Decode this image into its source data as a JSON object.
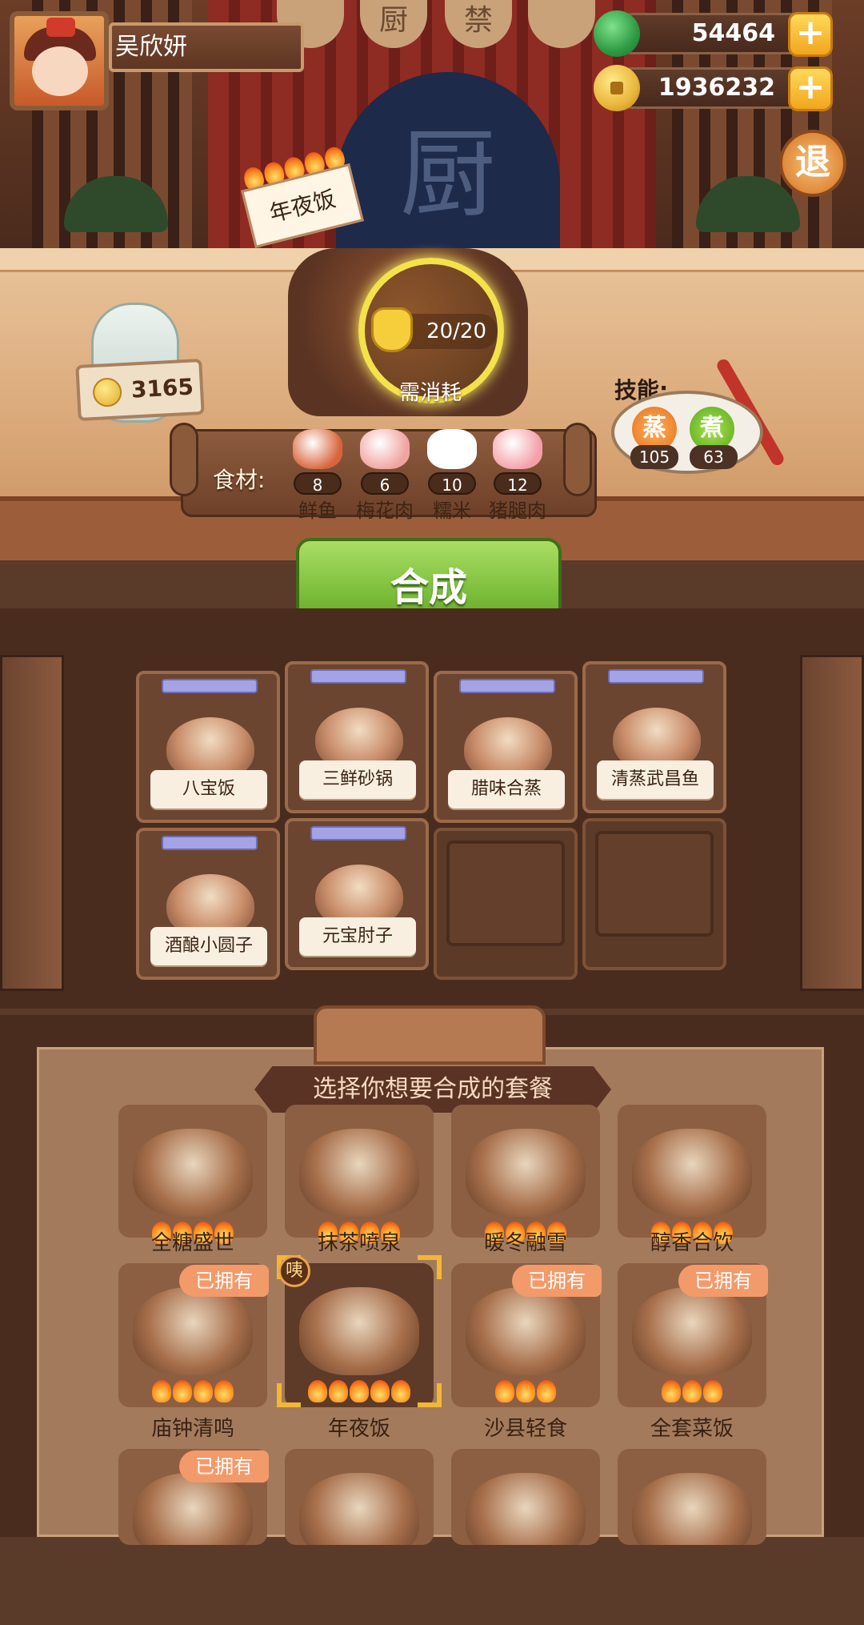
{
  "player": {
    "name": "吴欣妍"
  },
  "resources": {
    "jade": "54464",
    "coins": "1936232",
    "plus": "+"
  },
  "exit_label": "退",
  "stage_signs": [
    "",
    "厨",
    "禁",
    ""
  ],
  "screen_char": "厨",
  "dish": {
    "title": "年夜饭",
    "consume": "20/20",
    "need_label": "需消耗",
    "flames": 5
  },
  "bottle_price": "3165",
  "skills": {
    "label": "技能:",
    "items": [
      {
        "name": "蒸",
        "count": "105"
      },
      {
        "name": "煮",
        "count": "63"
      }
    ]
  },
  "ingredients": {
    "label": "食材:",
    "items": [
      {
        "name": "鲜鱼",
        "count": "8",
        "color": "#d9643a"
      },
      {
        "name": "梅花肉",
        "count": "6",
        "color": "#f0a3a0"
      },
      {
        "name": "糯米",
        "count": "10",
        "color": "#ffffff"
      },
      {
        "name": "猪腿肉",
        "count": "12",
        "color": "#f3a0a8"
      }
    ]
  },
  "synth_button": "合成",
  "recipes": [
    {
      "name": "八宝饭"
    },
    {
      "name": "三鲜砂锅"
    },
    {
      "name": "腊味合蒸"
    },
    {
      "name": "清蒸武昌鱼"
    },
    {
      "name": "酒酿小圆子"
    },
    {
      "name": "元宝肘子"
    }
  ],
  "panel": {
    "title": "选择你想要合成的套餐",
    "owned_label": "已拥有",
    "ban_label": "咦",
    "sets": [
      {
        "name": "全糖盛世",
        "flames": 4,
        "owned": false
      },
      {
        "name": "抹茶喷泉",
        "flames": 4,
        "owned": false
      },
      {
        "name": "暖冬融雪",
        "flames": 4,
        "owned": false
      },
      {
        "name": "醇香合饮",
        "flames": 4,
        "owned": false
      },
      {
        "name": "庙钟清鸣",
        "flames": 4,
        "owned": true
      },
      {
        "name": "年夜饭",
        "flames": 5,
        "owned": false,
        "selected": true
      },
      {
        "name": "沙县轻食",
        "flames": 3,
        "owned": true
      },
      {
        "name": "全套菜饭",
        "flames": 3,
        "owned": true
      },
      {
        "name": "",
        "flames": 0,
        "owned": true
      },
      {
        "name": "",
        "flames": 0,
        "owned": false
      },
      {
        "name": "",
        "flames": 0,
        "owned": false
      },
      {
        "name": "",
        "flames": 0,
        "owned": false
      }
    ]
  }
}
